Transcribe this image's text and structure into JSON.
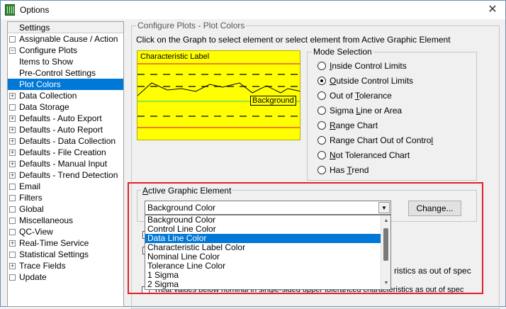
{
  "window": {
    "title": "Options",
    "close_glyph": "✕"
  },
  "sidebar": {
    "header": "Settings",
    "items": [
      {
        "label": "Assignable Cause / Action",
        "box": "",
        "indent": 0
      },
      {
        "label": "Configure Plots",
        "box": "−",
        "indent": 0
      },
      {
        "label": "Items to Show",
        "box": null,
        "indent": 1
      },
      {
        "label": "Pre-Control Settings",
        "box": null,
        "indent": 1
      },
      {
        "label": "Plot Colors",
        "box": null,
        "indent": 1,
        "selected": true
      },
      {
        "label": "Data Collection",
        "box": "+",
        "indent": 0
      },
      {
        "label": "Data Storage",
        "box": "",
        "indent": 0
      },
      {
        "label": "Defaults - Auto Export",
        "box": "+",
        "indent": 0
      },
      {
        "label": "Defaults - Auto Report",
        "box": "+",
        "indent": 0
      },
      {
        "label": "Defaults - Data Collection",
        "box": "+",
        "indent": 0
      },
      {
        "label": "Defaults - File Creation",
        "box": "+",
        "indent": 0
      },
      {
        "label": "Defaults - Manual Input",
        "box": "+",
        "indent": 0
      },
      {
        "label": "Defaults - Trend Detection",
        "box": "+",
        "indent": 0
      },
      {
        "label": "Email",
        "box": "",
        "indent": 0
      },
      {
        "label": "Filters",
        "box": "",
        "indent": 0
      },
      {
        "label": "Global",
        "box": "",
        "indent": 0
      },
      {
        "label": "Miscellaneous",
        "box": "",
        "indent": 0
      },
      {
        "label": "QC-View",
        "box": "",
        "indent": 0
      },
      {
        "label": "Real-Time Service",
        "box": "+",
        "indent": 0
      },
      {
        "label": "Statistical Settings",
        "box": "",
        "indent": 0
      },
      {
        "label": "Trace Fields",
        "box": "+",
        "indent": 0
      },
      {
        "label": "Update",
        "box": "",
        "indent": 0
      }
    ]
  },
  "configure": {
    "group_title": "Configure Plots - Plot Colors",
    "instruction": "Click on the Graph to select element or select element from Active Graphic Element",
    "preview": {
      "char_label": "Characteristic Label",
      "background_label": "Background"
    }
  },
  "mode": {
    "title": "Mode Selection",
    "options": [
      {
        "pre": "",
        "u": "I",
        "post": "nside Control Limits",
        "checked": false
      },
      {
        "pre": "",
        "u": "O",
        "post": "utside Control Limits",
        "checked": true
      },
      {
        "pre": "Out of ",
        "u": "T",
        "post": "olerance",
        "checked": false
      },
      {
        "pre": "Sigma ",
        "u": "L",
        "post": "ine or Area",
        "checked": false
      },
      {
        "pre": "",
        "u": "R",
        "post": "ange Chart",
        "checked": false
      },
      {
        "pre": "Range Chart Out of Contro",
        "u": "l",
        "post": "",
        "checked": false
      },
      {
        "pre": "",
        "u": "N",
        "post": "ot Toleranced Chart",
        "checked": false
      },
      {
        "pre": "Has ",
        "u": "T",
        "post": "rend",
        "checked": false
      }
    ]
  },
  "active": {
    "title_pre": "",
    "title_u": "A",
    "title_post": "ctive Graphic Element",
    "selected": "Background Color",
    "change_label": "Change...",
    "options": [
      "Background Color",
      "Control Line Color",
      "Data Line Color",
      "Characteristic Label Color",
      "Nominal Line Color",
      "Tolerance Line Color",
      "1 Sigma",
      "2 Sigma"
    ],
    "highlighted_index": 2
  },
  "behind": {
    "text1": "ristics as out of spec",
    "text2": "ristics as out of spec",
    "text3": "Treat values below nominal in single-sided upper toleranced characteristics as out of spec"
  }
}
